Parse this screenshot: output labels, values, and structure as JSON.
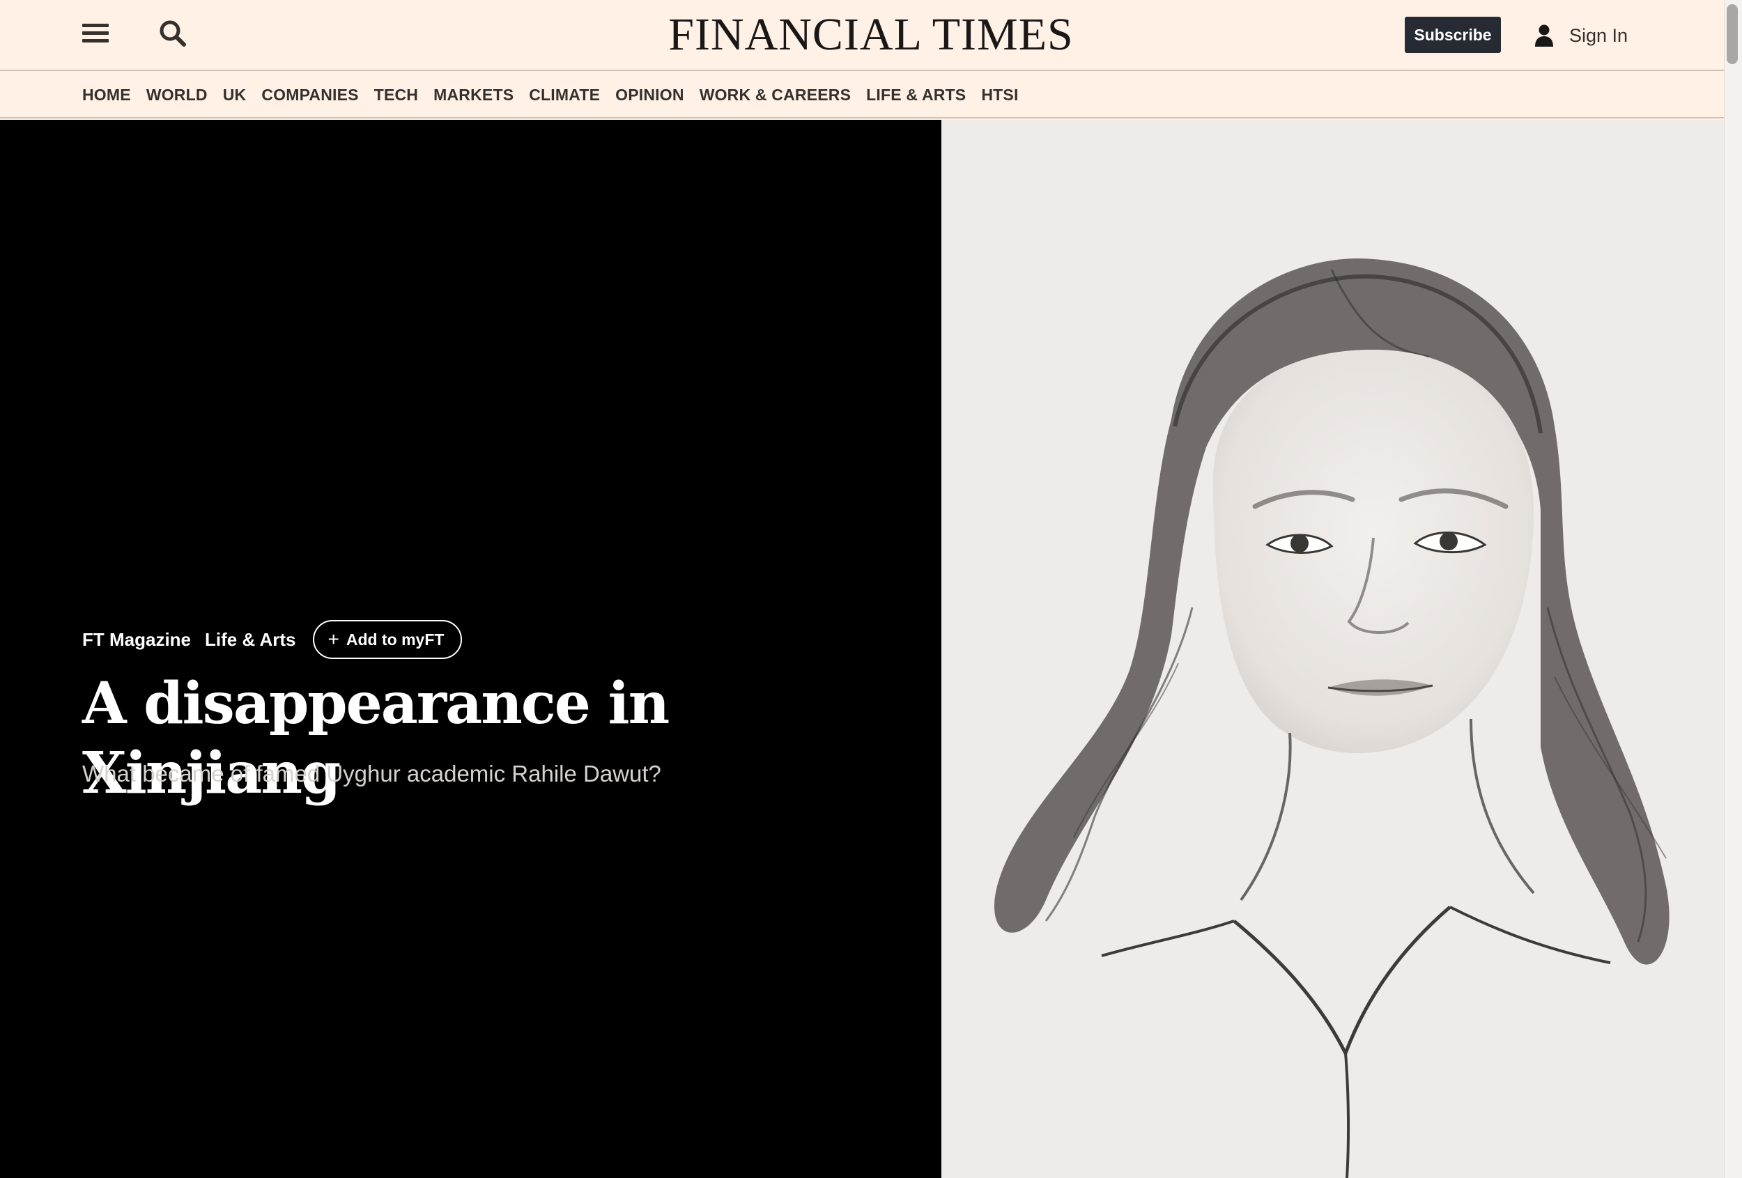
{
  "header": {
    "brand": "FINANCIAL TIMES",
    "menu_icon": "hamburger-menu-icon",
    "search_icon": "search-icon",
    "subscribe_label": "Subscribe",
    "signin_icon": "person-icon",
    "signin_label": "Sign In"
  },
  "nav": {
    "items": [
      {
        "label": "HOME"
      },
      {
        "label": "WORLD"
      },
      {
        "label": "UK"
      },
      {
        "label": "COMPANIES"
      },
      {
        "label": "TECH"
      },
      {
        "label": "MARKETS"
      },
      {
        "label": "CLIMATE"
      },
      {
        "label": "OPINION"
      },
      {
        "label": "WORK & CAREERS"
      },
      {
        "label": "LIFE & ARTS"
      },
      {
        "label": "HTSI"
      }
    ]
  },
  "article": {
    "tags": [
      "FT Magazine",
      "Life & Arts"
    ],
    "add_myft_label": "Add to myFT",
    "add_myft_icon": "plus-icon",
    "headline": "A disappearance in Xinjiang",
    "standfirst": "What became of famed Uyghur academic Rahile Dawut?"
  },
  "colors": {
    "page_background": "#fff1e5",
    "hero_left_background": "#000000",
    "subscribe_background": "#262a33",
    "text_dark": "#33302e",
    "illustration_background": "#efebe8"
  }
}
